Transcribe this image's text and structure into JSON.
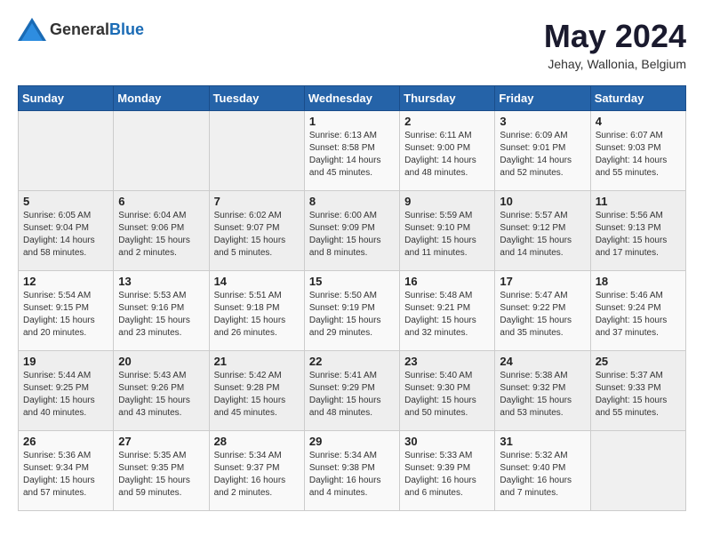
{
  "header": {
    "logo_general": "General",
    "logo_blue": "Blue",
    "month_year": "May 2024",
    "location": "Jehay, Wallonia, Belgium"
  },
  "calendar": {
    "days_of_week": [
      "Sunday",
      "Monday",
      "Tuesday",
      "Wednesday",
      "Thursday",
      "Friday",
      "Saturday"
    ],
    "weeks": [
      [
        {
          "day": "",
          "info": ""
        },
        {
          "day": "",
          "info": ""
        },
        {
          "day": "",
          "info": ""
        },
        {
          "day": "1",
          "info": "Sunrise: 6:13 AM\nSunset: 8:58 PM\nDaylight: 14 hours\nand 45 minutes."
        },
        {
          "day": "2",
          "info": "Sunrise: 6:11 AM\nSunset: 9:00 PM\nDaylight: 14 hours\nand 48 minutes."
        },
        {
          "day": "3",
          "info": "Sunrise: 6:09 AM\nSunset: 9:01 PM\nDaylight: 14 hours\nand 52 minutes."
        },
        {
          "day": "4",
          "info": "Sunrise: 6:07 AM\nSunset: 9:03 PM\nDaylight: 14 hours\nand 55 minutes."
        }
      ],
      [
        {
          "day": "5",
          "info": "Sunrise: 6:05 AM\nSunset: 9:04 PM\nDaylight: 14 hours\nand 58 minutes."
        },
        {
          "day": "6",
          "info": "Sunrise: 6:04 AM\nSunset: 9:06 PM\nDaylight: 15 hours\nand 2 minutes."
        },
        {
          "day": "7",
          "info": "Sunrise: 6:02 AM\nSunset: 9:07 PM\nDaylight: 15 hours\nand 5 minutes."
        },
        {
          "day": "8",
          "info": "Sunrise: 6:00 AM\nSunset: 9:09 PM\nDaylight: 15 hours\nand 8 minutes."
        },
        {
          "day": "9",
          "info": "Sunrise: 5:59 AM\nSunset: 9:10 PM\nDaylight: 15 hours\nand 11 minutes."
        },
        {
          "day": "10",
          "info": "Sunrise: 5:57 AM\nSunset: 9:12 PM\nDaylight: 15 hours\nand 14 minutes."
        },
        {
          "day": "11",
          "info": "Sunrise: 5:56 AM\nSunset: 9:13 PM\nDaylight: 15 hours\nand 17 minutes."
        }
      ],
      [
        {
          "day": "12",
          "info": "Sunrise: 5:54 AM\nSunset: 9:15 PM\nDaylight: 15 hours\nand 20 minutes."
        },
        {
          "day": "13",
          "info": "Sunrise: 5:53 AM\nSunset: 9:16 PM\nDaylight: 15 hours\nand 23 minutes."
        },
        {
          "day": "14",
          "info": "Sunrise: 5:51 AM\nSunset: 9:18 PM\nDaylight: 15 hours\nand 26 minutes."
        },
        {
          "day": "15",
          "info": "Sunrise: 5:50 AM\nSunset: 9:19 PM\nDaylight: 15 hours\nand 29 minutes."
        },
        {
          "day": "16",
          "info": "Sunrise: 5:48 AM\nSunset: 9:21 PM\nDaylight: 15 hours\nand 32 minutes."
        },
        {
          "day": "17",
          "info": "Sunrise: 5:47 AM\nSunset: 9:22 PM\nDaylight: 15 hours\nand 35 minutes."
        },
        {
          "day": "18",
          "info": "Sunrise: 5:46 AM\nSunset: 9:24 PM\nDaylight: 15 hours\nand 37 minutes."
        }
      ],
      [
        {
          "day": "19",
          "info": "Sunrise: 5:44 AM\nSunset: 9:25 PM\nDaylight: 15 hours\nand 40 minutes."
        },
        {
          "day": "20",
          "info": "Sunrise: 5:43 AM\nSunset: 9:26 PM\nDaylight: 15 hours\nand 43 minutes."
        },
        {
          "day": "21",
          "info": "Sunrise: 5:42 AM\nSunset: 9:28 PM\nDaylight: 15 hours\nand 45 minutes."
        },
        {
          "day": "22",
          "info": "Sunrise: 5:41 AM\nSunset: 9:29 PM\nDaylight: 15 hours\nand 48 minutes."
        },
        {
          "day": "23",
          "info": "Sunrise: 5:40 AM\nSunset: 9:30 PM\nDaylight: 15 hours\nand 50 minutes."
        },
        {
          "day": "24",
          "info": "Sunrise: 5:38 AM\nSunset: 9:32 PM\nDaylight: 15 hours\nand 53 minutes."
        },
        {
          "day": "25",
          "info": "Sunrise: 5:37 AM\nSunset: 9:33 PM\nDaylight: 15 hours\nand 55 minutes."
        }
      ],
      [
        {
          "day": "26",
          "info": "Sunrise: 5:36 AM\nSunset: 9:34 PM\nDaylight: 15 hours\nand 57 minutes."
        },
        {
          "day": "27",
          "info": "Sunrise: 5:35 AM\nSunset: 9:35 PM\nDaylight: 15 hours\nand 59 minutes."
        },
        {
          "day": "28",
          "info": "Sunrise: 5:34 AM\nSunset: 9:37 PM\nDaylight: 16 hours\nand 2 minutes."
        },
        {
          "day": "29",
          "info": "Sunrise: 5:34 AM\nSunset: 9:38 PM\nDaylight: 16 hours\nand 4 minutes."
        },
        {
          "day": "30",
          "info": "Sunrise: 5:33 AM\nSunset: 9:39 PM\nDaylight: 16 hours\nand 6 minutes."
        },
        {
          "day": "31",
          "info": "Sunrise: 5:32 AM\nSunset: 9:40 PM\nDaylight: 16 hours\nand 7 minutes."
        },
        {
          "day": "",
          "info": ""
        }
      ]
    ]
  }
}
